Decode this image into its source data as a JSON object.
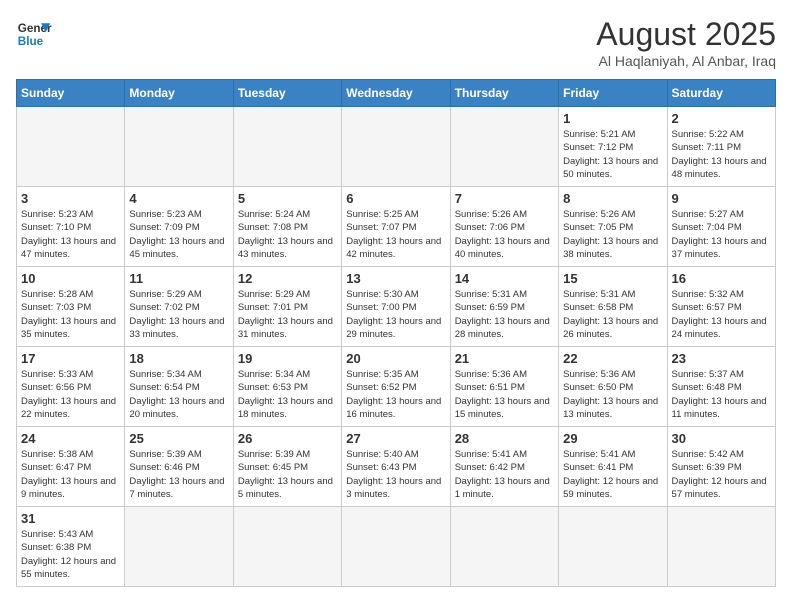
{
  "header": {
    "logo_general": "General",
    "logo_blue": "Blue",
    "month_title": "August 2025",
    "location": "Al Haqlaniyah, Al Anbar, Iraq"
  },
  "days_of_week": [
    "Sunday",
    "Monday",
    "Tuesday",
    "Wednesday",
    "Thursday",
    "Friday",
    "Saturday"
  ],
  "weeks": [
    [
      {
        "day": "",
        "info": ""
      },
      {
        "day": "",
        "info": ""
      },
      {
        "day": "",
        "info": ""
      },
      {
        "day": "",
        "info": ""
      },
      {
        "day": "",
        "info": ""
      },
      {
        "day": "1",
        "info": "Sunrise: 5:21 AM\nSunset: 7:12 PM\nDaylight: 13 hours and 50 minutes."
      },
      {
        "day": "2",
        "info": "Sunrise: 5:22 AM\nSunset: 7:11 PM\nDaylight: 13 hours and 48 minutes."
      }
    ],
    [
      {
        "day": "3",
        "info": "Sunrise: 5:23 AM\nSunset: 7:10 PM\nDaylight: 13 hours and 47 minutes."
      },
      {
        "day": "4",
        "info": "Sunrise: 5:23 AM\nSunset: 7:09 PM\nDaylight: 13 hours and 45 minutes."
      },
      {
        "day": "5",
        "info": "Sunrise: 5:24 AM\nSunset: 7:08 PM\nDaylight: 13 hours and 43 minutes."
      },
      {
        "day": "6",
        "info": "Sunrise: 5:25 AM\nSunset: 7:07 PM\nDaylight: 13 hours and 42 minutes."
      },
      {
        "day": "7",
        "info": "Sunrise: 5:26 AM\nSunset: 7:06 PM\nDaylight: 13 hours and 40 minutes."
      },
      {
        "day": "8",
        "info": "Sunrise: 5:26 AM\nSunset: 7:05 PM\nDaylight: 13 hours and 38 minutes."
      },
      {
        "day": "9",
        "info": "Sunrise: 5:27 AM\nSunset: 7:04 PM\nDaylight: 13 hours and 37 minutes."
      }
    ],
    [
      {
        "day": "10",
        "info": "Sunrise: 5:28 AM\nSunset: 7:03 PM\nDaylight: 13 hours and 35 minutes."
      },
      {
        "day": "11",
        "info": "Sunrise: 5:29 AM\nSunset: 7:02 PM\nDaylight: 13 hours and 33 minutes."
      },
      {
        "day": "12",
        "info": "Sunrise: 5:29 AM\nSunset: 7:01 PM\nDaylight: 13 hours and 31 minutes."
      },
      {
        "day": "13",
        "info": "Sunrise: 5:30 AM\nSunset: 7:00 PM\nDaylight: 13 hours and 29 minutes."
      },
      {
        "day": "14",
        "info": "Sunrise: 5:31 AM\nSunset: 6:59 PM\nDaylight: 13 hours and 28 minutes."
      },
      {
        "day": "15",
        "info": "Sunrise: 5:31 AM\nSunset: 6:58 PM\nDaylight: 13 hours and 26 minutes."
      },
      {
        "day": "16",
        "info": "Sunrise: 5:32 AM\nSunset: 6:57 PM\nDaylight: 13 hours and 24 minutes."
      }
    ],
    [
      {
        "day": "17",
        "info": "Sunrise: 5:33 AM\nSunset: 6:56 PM\nDaylight: 13 hours and 22 minutes."
      },
      {
        "day": "18",
        "info": "Sunrise: 5:34 AM\nSunset: 6:54 PM\nDaylight: 13 hours and 20 minutes."
      },
      {
        "day": "19",
        "info": "Sunrise: 5:34 AM\nSunset: 6:53 PM\nDaylight: 13 hours and 18 minutes."
      },
      {
        "day": "20",
        "info": "Sunrise: 5:35 AM\nSunset: 6:52 PM\nDaylight: 13 hours and 16 minutes."
      },
      {
        "day": "21",
        "info": "Sunrise: 5:36 AM\nSunset: 6:51 PM\nDaylight: 13 hours and 15 minutes."
      },
      {
        "day": "22",
        "info": "Sunrise: 5:36 AM\nSunset: 6:50 PM\nDaylight: 13 hours and 13 minutes."
      },
      {
        "day": "23",
        "info": "Sunrise: 5:37 AM\nSunset: 6:48 PM\nDaylight: 13 hours and 11 minutes."
      }
    ],
    [
      {
        "day": "24",
        "info": "Sunrise: 5:38 AM\nSunset: 6:47 PM\nDaylight: 13 hours and 9 minutes."
      },
      {
        "day": "25",
        "info": "Sunrise: 5:39 AM\nSunset: 6:46 PM\nDaylight: 13 hours and 7 minutes."
      },
      {
        "day": "26",
        "info": "Sunrise: 5:39 AM\nSunset: 6:45 PM\nDaylight: 13 hours and 5 minutes."
      },
      {
        "day": "27",
        "info": "Sunrise: 5:40 AM\nSunset: 6:43 PM\nDaylight: 13 hours and 3 minutes."
      },
      {
        "day": "28",
        "info": "Sunrise: 5:41 AM\nSunset: 6:42 PM\nDaylight: 13 hours and 1 minute."
      },
      {
        "day": "29",
        "info": "Sunrise: 5:41 AM\nSunset: 6:41 PM\nDaylight: 12 hours and 59 minutes."
      },
      {
        "day": "30",
        "info": "Sunrise: 5:42 AM\nSunset: 6:39 PM\nDaylight: 12 hours and 57 minutes."
      }
    ],
    [
      {
        "day": "31",
        "info": "Sunrise: 5:43 AM\nSunset: 6:38 PM\nDaylight: 12 hours and 55 minutes."
      },
      {
        "day": "",
        "info": ""
      },
      {
        "day": "",
        "info": ""
      },
      {
        "day": "",
        "info": ""
      },
      {
        "day": "",
        "info": ""
      },
      {
        "day": "",
        "info": ""
      },
      {
        "day": "",
        "info": ""
      }
    ]
  ]
}
